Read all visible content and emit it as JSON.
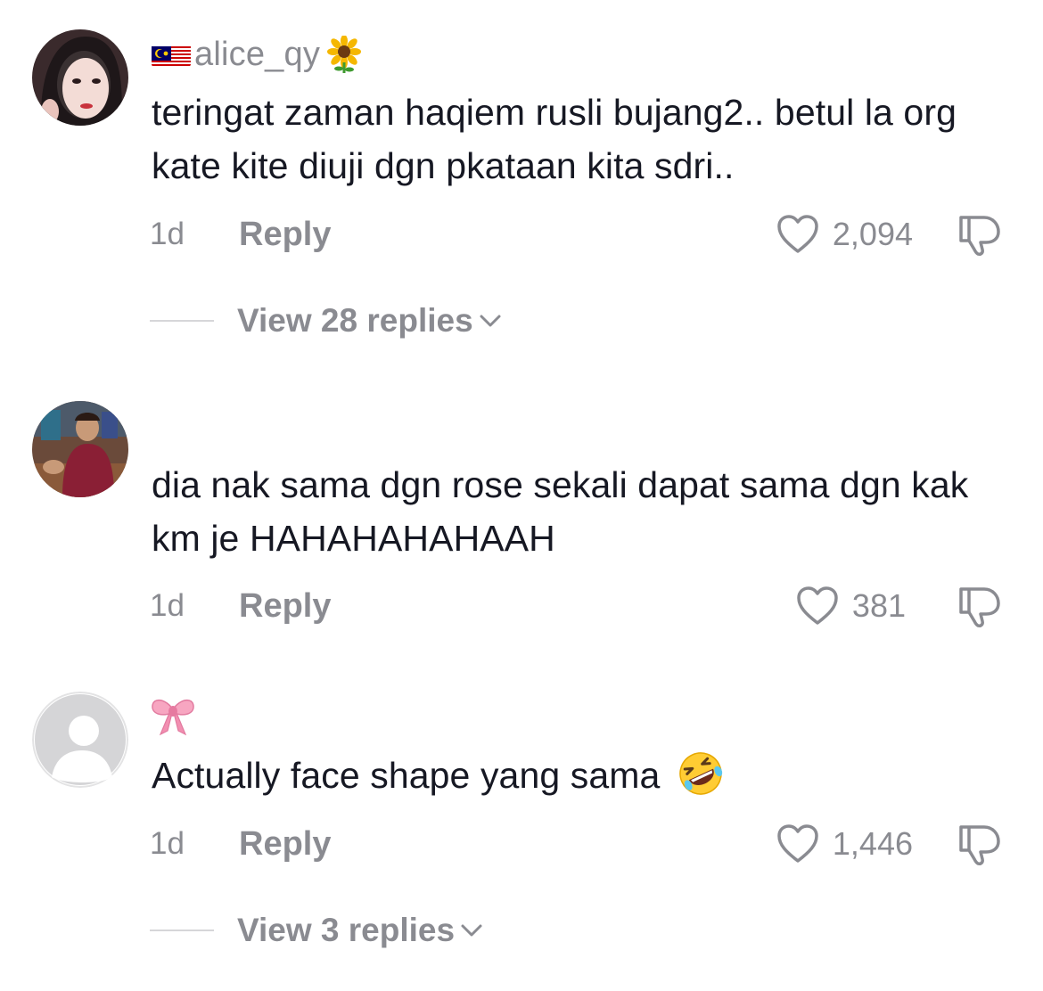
{
  "comments": [
    {
      "username": "alice_qy",
      "has_flag": true,
      "flag_icon": "malaysia-flag-icon",
      "username_suffix_icon": "sunflower-icon",
      "text": "teringat zaman haqiem rusli bujang2.. betul la org kate kite diuji dgn pkataan kita sdri..",
      "age": "1d",
      "reply_label": "Reply",
      "likes": "2,094",
      "view_replies": "View 28 replies"
    },
    {
      "username": "",
      "text": "dia nak sama dgn rose sekali dapat sama dgn kak km je HAHAHAHAHAAH",
      "age": "1d",
      "reply_label": "Reply",
      "likes": "381"
    },
    {
      "username_icon": "pink-bow-icon",
      "text": "Actually face shape yang sama",
      "text_suffix_icon": "rolling-on-floor-laughing-icon",
      "age": "1d",
      "reply_label": "Reply",
      "likes": "1,446",
      "view_replies": "View 3 replies"
    }
  ],
  "colors": {
    "text_primary": "#161823",
    "text_secondary": "#8a8b91",
    "divider": "#d6d6d9",
    "background": "#ffffff"
  }
}
